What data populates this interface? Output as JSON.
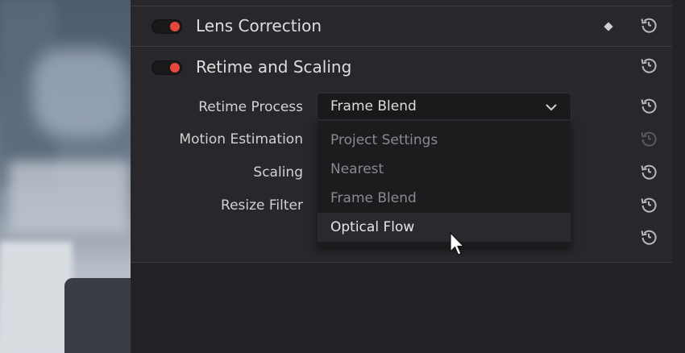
{
  "sections": [
    {
      "title": "Lens Correction",
      "enabled": true,
      "has_keyframe": true
    },
    {
      "title": "Retime and Scaling",
      "enabled": true,
      "has_keyframe": false
    }
  ],
  "retime": {
    "params": [
      {
        "label": "Retime Process"
      },
      {
        "label": "Motion Estimation"
      },
      {
        "label": "Scaling"
      },
      {
        "label": "Resize Filter"
      }
    ],
    "retime_process_value": "Frame Blend",
    "dropdown_options": [
      {
        "label": "Project Settings",
        "state": "dimmed"
      },
      {
        "label": "Nearest",
        "state": "dimmed"
      },
      {
        "label": "Frame Blend",
        "state": "dimmed"
      },
      {
        "label": "Optical Flow",
        "state": "highlighted"
      }
    ]
  },
  "icons": {
    "toggle_on_color": "#e8473c",
    "reset": "reset-icon",
    "keyframe": "keyframe-diamond-icon",
    "chevron": "chevron-down-icon",
    "cursor": "mouse-pointer-icon"
  }
}
